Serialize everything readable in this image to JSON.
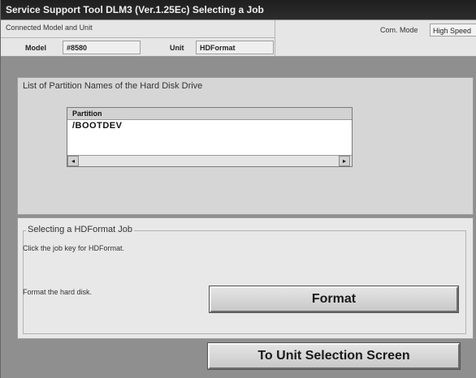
{
  "window": {
    "title": "Service Support Tool DLM3 (Ver.1.25Ec) Selecting a Job"
  },
  "info": {
    "connected_label": "Connected Model and Unit",
    "model_label": "Model",
    "model_value": "#8580",
    "unit_label": "Unit",
    "unit_value": "HDFormat",
    "com_mode_label": "Com. Mode",
    "com_mode_value": "High Speed"
  },
  "partition_panel": {
    "title": "List of Partition Names of the Hard Disk Drive",
    "column_header": "Partition",
    "rows": [
      "/BOOTDEV"
    ],
    "scroll_left": "◂",
    "scroll_right": "▸"
  },
  "job_panel": {
    "title": "Selecting a HDFormat Job",
    "instruction": "Click the job key for HDFormat.",
    "format_description": "Format the hard disk.",
    "format_button": "Format"
  },
  "footer": {
    "unit_selection_button": "To Unit Selection Screen"
  }
}
